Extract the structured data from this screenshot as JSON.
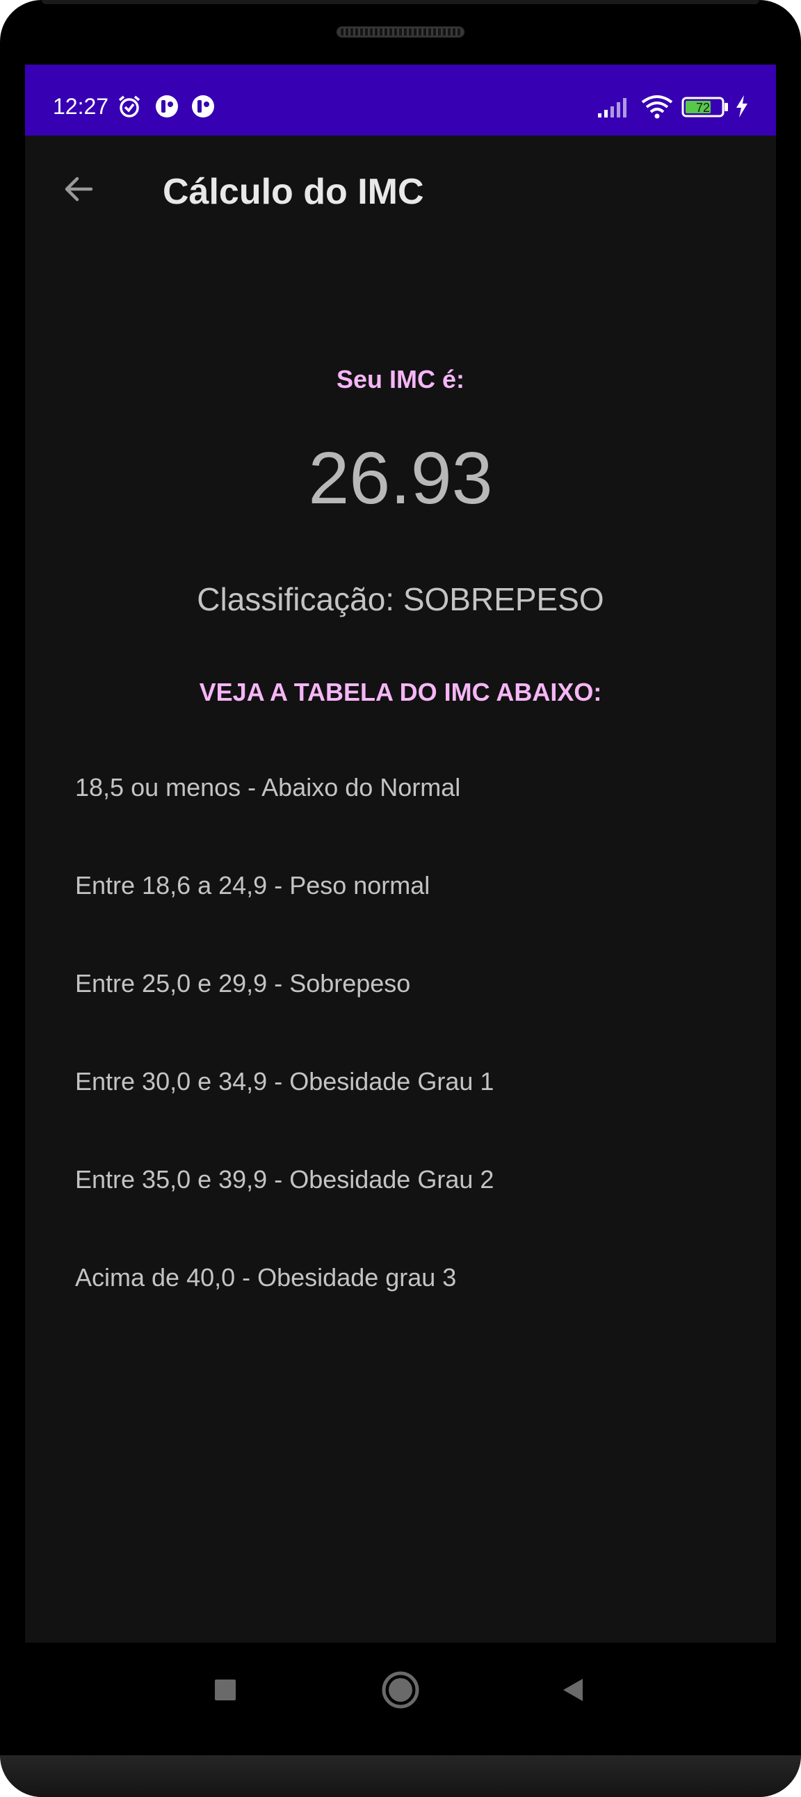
{
  "status_bar": {
    "time": "12:27",
    "battery_level": "72",
    "background_color": "#3700b3",
    "icons": [
      "alarm-icon",
      "app-notification-icon",
      "app-notification-icon",
      "signal-icon",
      "wifi-icon",
      "battery-icon",
      "charging-icon"
    ]
  },
  "app_bar": {
    "title": "Cálculo do IMC",
    "back_icon": "arrow-back-icon"
  },
  "result": {
    "label": "Seu IMC é:",
    "value": "26.93",
    "classification": "Classificação: SOBREPESO"
  },
  "table": {
    "title": "VEJA A TABELA DO IMC ABAIXO:",
    "rows": [
      "18,5 ou menos - Abaixo do Normal",
      "Entre 18,6 a 24,9 - Peso normal",
      "Entre 25,0 e 29,9 - Sobrepeso",
      "Entre 30,0 e 34,9 - Obesidade Grau 1",
      "Entre 35,0 e 39,9 - Obesidade Grau 2",
      "Acima de 40,0 - Obesidade grau 3"
    ]
  },
  "navigation": {
    "buttons": [
      "recents-square-icon",
      "home-circle-icon",
      "back-triangle-icon"
    ]
  },
  "colors": {
    "accent_pink": "#f6b6f7",
    "screen_background": "#121212",
    "text_gray": "#c4c4c4"
  }
}
